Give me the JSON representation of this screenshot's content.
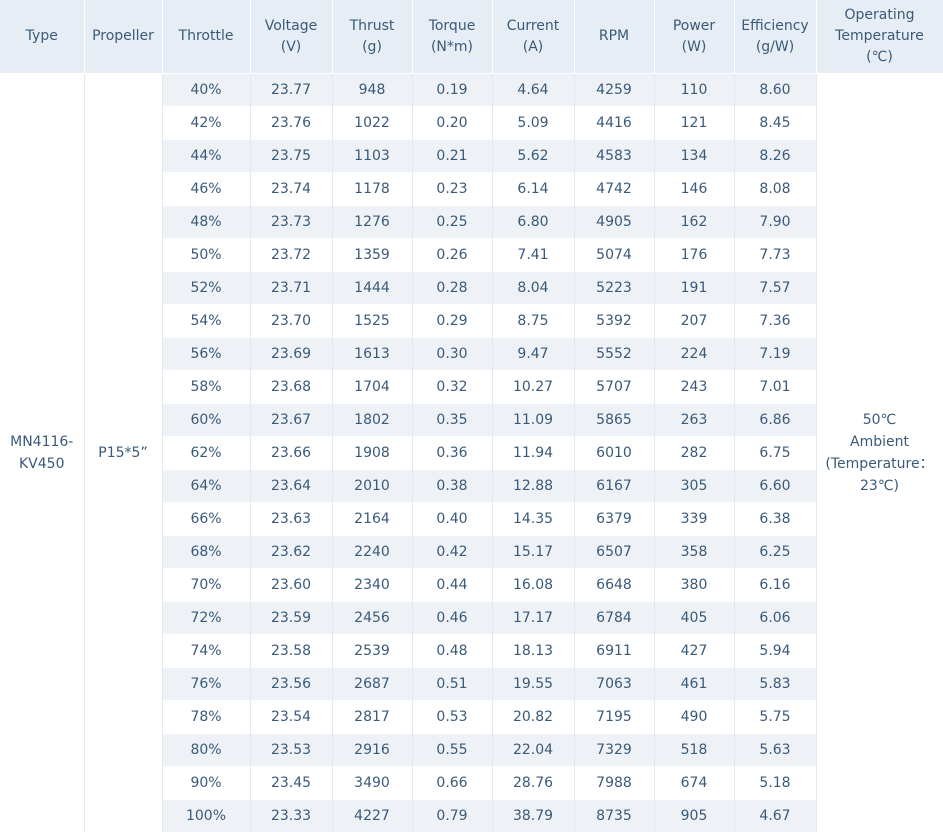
{
  "headers": [
    {
      "key": "type",
      "lines": [
        "Type"
      ]
    },
    {
      "key": "propeller",
      "lines": [
        "Propeller"
      ]
    },
    {
      "key": "throttle",
      "lines": [
        "Throttle"
      ]
    },
    {
      "key": "voltage",
      "lines": [
        "Voltage",
        "(V)"
      ]
    },
    {
      "key": "thrust",
      "lines": [
        "Thrust",
        "(g)"
      ]
    },
    {
      "key": "torque",
      "lines": [
        "Torque",
        "(N*m)"
      ]
    },
    {
      "key": "current",
      "lines": [
        "Current",
        "(A)"
      ]
    },
    {
      "key": "rpm",
      "lines": [
        "RPM"
      ]
    },
    {
      "key": "power",
      "lines": [
        "Power",
        "(W)"
      ]
    },
    {
      "key": "efficiency",
      "lines": [
        "Efficiency",
        "(g/W)"
      ]
    },
    {
      "key": "operating_temperature",
      "lines": [
        "Operating",
        "Temperature",
        "(℃)"
      ]
    }
  ],
  "type_lines": [
    "MN4116-",
    "KV450"
  ],
  "propeller": "P15*5”",
  "temperature_lines": [
    "50℃",
    "Ambient",
    "(Temperature：",
    "23℃)"
  ],
  "rows": [
    {
      "throttle": "40%",
      "voltage": "23.77",
      "thrust": "948",
      "torque": "0.19",
      "current": "4.64",
      "rpm": "4259",
      "power": "110",
      "efficiency": "8.60"
    },
    {
      "throttle": "42%",
      "voltage": "23.76",
      "thrust": "1022",
      "torque": "0.20",
      "current": "5.09",
      "rpm": "4416",
      "power": "121",
      "efficiency": "8.45"
    },
    {
      "throttle": "44%",
      "voltage": "23.75",
      "thrust": "1103",
      "torque": "0.21",
      "current": "5.62",
      "rpm": "4583",
      "power": "134",
      "efficiency": "8.26"
    },
    {
      "throttle": "46%",
      "voltage": "23.74",
      "thrust": "1178",
      "torque": "0.23",
      "current": "6.14",
      "rpm": "4742",
      "power": "146",
      "efficiency": "8.08"
    },
    {
      "throttle": "48%",
      "voltage": "23.73",
      "thrust": "1276",
      "torque": "0.25",
      "current": "6.80",
      "rpm": "4905",
      "power": "162",
      "efficiency": "7.90"
    },
    {
      "throttle": "50%",
      "voltage": "23.72",
      "thrust": "1359",
      "torque": "0.26",
      "current": "7.41",
      "rpm": "5074",
      "power": "176",
      "efficiency": "7.73"
    },
    {
      "throttle": "52%",
      "voltage": "23.71",
      "thrust": "1444",
      "torque": "0.28",
      "current": "8.04",
      "rpm": "5223",
      "power": "191",
      "efficiency": "7.57"
    },
    {
      "throttle": "54%",
      "voltage": "23.70",
      "thrust": "1525",
      "torque": "0.29",
      "current": "8.75",
      "rpm": "5392",
      "power": "207",
      "efficiency": "7.36"
    },
    {
      "throttle": "56%",
      "voltage": "23.69",
      "thrust": "1613",
      "torque": "0.30",
      "current": "9.47",
      "rpm": "5552",
      "power": "224",
      "efficiency": "7.19"
    },
    {
      "throttle": "58%",
      "voltage": "23.68",
      "thrust": "1704",
      "torque": "0.32",
      "current": "10.27",
      "rpm": "5707",
      "power": "243",
      "efficiency": "7.01"
    },
    {
      "throttle": "60%",
      "voltage": "23.67",
      "thrust": "1802",
      "torque": "0.35",
      "current": "11.09",
      "rpm": "5865",
      "power": "263",
      "efficiency": "6.86"
    },
    {
      "throttle": "62%",
      "voltage": "23.66",
      "thrust": "1908",
      "torque": "0.36",
      "current": "11.94",
      "rpm": "6010",
      "power": "282",
      "efficiency": "6.75"
    },
    {
      "throttle": "64%",
      "voltage": "23.64",
      "thrust": "2010",
      "torque": "0.38",
      "current": "12.88",
      "rpm": "6167",
      "power": "305",
      "efficiency": "6.60"
    },
    {
      "throttle": "66%",
      "voltage": "23.63",
      "thrust": "2164",
      "torque": "0.40",
      "current": "14.35",
      "rpm": "6379",
      "power": "339",
      "efficiency": "6.38"
    },
    {
      "throttle": "68%",
      "voltage": "23.62",
      "thrust": "2240",
      "torque": "0.42",
      "current": "15.17",
      "rpm": "6507",
      "power": "358",
      "efficiency": "6.25"
    },
    {
      "throttle": "70%",
      "voltage": "23.60",
      "thrust": "2340",
      "torque": "0.44",
      "current": "16.08",
      "rpm": "6648",
      "power": "380",
      "efficiency": "6.16"
    },
    {
      "throttle": "72%",
      "voltage": "23.59",
      "thrust": "2456",
      "torque": "0.46",
      "current": "17.17",
      "rpm": "6784",
      "power": "405",
      "efficiency": "6.06"
    },
    {
      "throttle": "74%",
      "voltage": "23.58",
      "thrust": "2539",
      "torque": "0.48",
      "current": "18.13",
      "rpm": "6911",
      "power": "427",
      "efficiency": "5.94"
    },
    {
      "throttle": "76%",
      "voltage": "23.56",
      "thrust": "2687",
      "torque": "0.51",
      "current": "19.55",
      "rpm": "7063",
      "power": "461",
      "efficiency": "5.83"
    },
    {
      "throttle": "78%",
      "voltage": "23.54",
      "thrust": "2817",
      "torque": "0.53",
      "current": "20.82",
      "rpm": "7195",
      "power": "490",
      "efficiency": "5.75"
    },
    {
      "throttle": "80%",
      "voltage": "23.53",
      "thrust": "2916",
      "torque": "0.55",
      "current": "22.04",
      "rpm": "7329",
      "power": "518",
      "efficiency": "5.63"
    },
    {
      "throttle": "90%",
      "voltage": "23.45",
      "thrust": "3490",
      "torque": "0.66",
      "current": "28.76",
      "rpm": "7988",
      "power": "674",
      "efficiency": "5.18"
    },
    {
      "throttle": "100%",
      "voltage": "23.33",
      "thrust": "4227",
      "torque": "0.79",
      "current": "38.79",
      "rpm": "8735",
      "power": "905",
      "efficiency": "4.67"
    }
  ]
}
